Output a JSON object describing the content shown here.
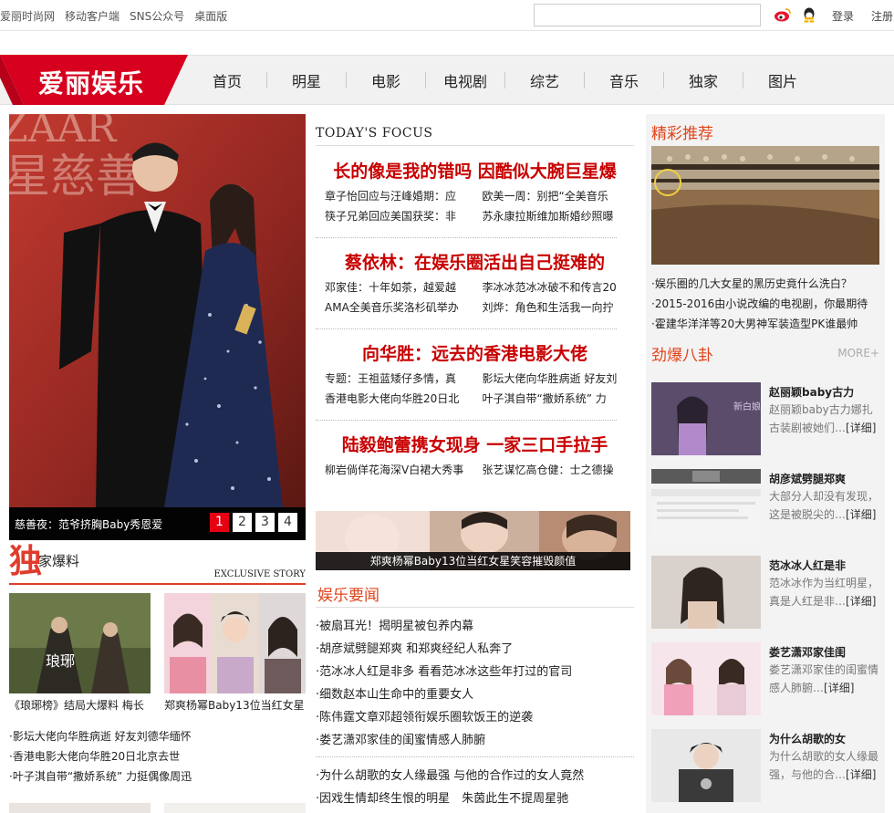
{
  "topbar": {
    "links": [
      "爱丽时尚网",
      "移动客户端",
      "SNS公众号",
      "桌面版"
    ],
    "search_placeholder": "",
    "login": "登录",
    "register": "注册"
  },
  "logo": {
    "text": "爱丽娱乐",
    "color": "#d7001e"
  },
  "nav": [
    "首页",
    "明星",
    "电影",
    "电视剧",
    "综艺",
    "音乐",
    "独家",
    "图片"
  ],
  "hero": {
    "caption": "慈善夜：范爷挤胸Baby秀恩爱",
    "pages": [
      "1",
      "2",
      "3",
      "4"
    ],
    "active_page": "1"
  },
  "exclusive": {
    "char": "独",
    "title": "家爆料",
    "en": "EXCLUSIVE STORY",
    "thumbs": [
      {
        "caption": "《琅琊榜》结局大爆料 梅长"
      },
      {
        "caption": "郑爽杨幂Baby13位当红女星"
      }
    ],
    "list": [
      "·影坛大佬向华胜病逝 好友刘德华缅怀",
      "·香港电影大佬向华胜20日北京去世",
      "·叶子淇自带“撒娇系统” 力挺偶像周迅"
    ]
  },
  "focus": {
    "title": "TODAY'S FOCUS",
    "stories": [
      {
        "headline": "长的像是我的错吗 因酷似大腕巨星爆",
        "subs": [
          "章子怡回应与汪峰婚期：应",
          "欧美一周：别把“全美音乐",
          "筷子兄弟回应美国获奖：非",
          "苏永康拉斯维加斯婚纱照曝"
        ]
      },
      {
        "headline": "蔡依林：在娱乐圈活出自己挺难的",
        "subs": [
          "邓家佳：十年如茶，越爱越",
          "李冰冰范冰冰破不和传言20",
          "AMA全美音乐奖洛杉矶举办",
          "刘烨：角色和生活我一向拧"
        ]
      },
      {
        "headline": "向华胜：远去的香港电影大佬",
        "subs": [
          "专题：王祖蓝矮仔多情，真",
          "影坛大佬向华胜病逝 好友刘",
          "香港电影大佬向华胜20日北",
          "叶子淇自带“撒娇系统” 力"
        ]
      },
      {
        "headline": "陆毅鲍蕾携女现身 一家三口手拉手",
        "subs": [
          "柳岩倘佯花海深V白裙大秀事",
          "张艺谋忆高仓健：士之德操"
        ]
      }
    ]
  },
  "mid_banner": {
    "caption": "郑爽杨幂Baby13位当红女星笑容摧毁颜值"
  },
  "news": {
    "title": "娱乐要闻",
    "items": [
      "·被扇耳光！揭明星被包养内幕",
      "·胡彦斌劈腿郑爽 和郑爽经纪人私奔了",
      "·范冰冰人红是非多 看看范冰冰这些年打过的官司",
      "·细数赵本山生命中的重要女人",
      "·陈伟霆文章邓超领衔娱乐圈软饭王的逆袭",
      "·娄艺潇邓家佳的闺蜜情感人肺腑"
    ],
    "items2": [
      "·为什么胡歌的女人缘最强 与他的合作过的女人竟然",
      "·因戏生情却终生恨的明星　朱茵此生不提周星驰"
    ]
  },
  "recommend": {
    "title": "精彩推荐",
    "list": [
      "·娱乐圈的几大女星的黑历史竟什么洗白？",
      "·2015-2016由小说改编的电视剧，你最期待",
      "·霍建华洋洋等20大男神军装造型PK谁最帅"
    ]
  },
  "gossip": {
    "title": "劲爆八卦",
    "more": "MORE+",
    "items": [
      {
        "title": "赵丽颖baby古力",
        "desc": "赵丽颖baby古力娜扎古装剧被她们…",
        "more": "[详细]"
      },
      {
        "title": "胡彦斌劈腿郑爽",
        "desc": "大部分人却没有发现，这是被脱尖的…",
        "more": "[详细]"
      },
      {
        "title": "范冰冰人红是非",
        "desc": "范冰冰作为当红明星，真是人红是非…",
        "more": "[详细]"
      },
      {
        "title": "娄艺潇邓家佳闺",
        "desc": "娄艺潇邓家佳的闺蜜情感人肺腑…",
        "more": "[详细]"
      },
      {
        "title": "为什么胡歌的女",
        "desc": "为什么胡歌的女人缘最强，与他的合…",
        "more": "[详细]"
      }
    ]
  },
  "colors": {
    "accent": "#d7001e",
    "headline": "#c80000",
    "section": "#e0441b"
  }
}
